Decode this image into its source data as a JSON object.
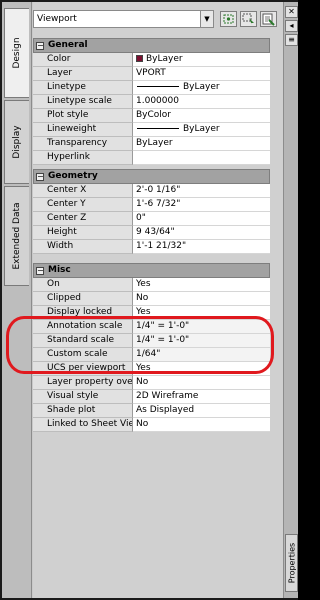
{
  "tabs": {
    "design": "Design",
    "display": "Display",
    "extended": "Extended Data",
    "properties": "Properties"
  },
  "selector": {
    "value": "Viewport"
  },
  "icons": {
    "toggle_pickadd": "pickadd-icon",
    "select_objects": "select-objects-icon",
    "quick_select": "quick-select-icon",
    "close": "close-icon",
    "autohide": "autohide-icon",
    "menu": "menu-icon"
  },
  "colors": {
    "color_swatch": "#7a1030",
    "highlight": "#e0191e"
  },
  "general": {
    "title": "General",
    "toggle": "−",
    "color": {
      "label": "Color",
      "value": "ByLayer"
    },
    "layer": {
      "label": "Layer",
      "value": "VPORT"
    },
    "linetype": {
      "label": "Linetype",
      "value": "ByLayer"
    },
    "linetype_scale": {
      "label": "Linetype scale",
      "value": "1.000000"
    },
    "plot_style": {
      "label": "Plot style",
      "value": "ByColor"
    },
    "lineweight": {
      "label": "Lineweight",
      "value": "ByLayer"
    },
    "transparency": {
      "label": "Transparency",
      "value": "ByLayer"
    },
    "hyperlink": {
      "label": "Hyperlink",
      "value": ""
    }
  },
  "geometry": {
    "title": "Geometry",
    "toggle": "−",
    "center_x": {
      "label": "Center X",
      "value": "2'-0 1/16\""
    },
    "center_y": {
      "label": "Center Y",
      "value": "1'-6 7/32\""
    },
    "center_z": {
      "label": "Center Z",
      "value": "0\""
    },
    "height": {
      "label": "Height",
      "value": "9 43/64\""
    },
    "width": {
      "label": "Width",
      "value": "1'-1 21/32\""
    }
  },
  "misc": {
    "title": "Misc",
    "toggle": "−",
    "on": {
      "label": "On",
      "value": "Yes"
    },
    "clipped": {
      "label": "Clipped",
      "value": "No"
    },
    "display_locked": {
      "label": "Display locked",
      "value": "Yes"
    },
    "annotation_scale": {
      "label": "Annotation scale",
      "value": "1/4\" = 1'-0\""
    },
    "standard_scale": {
      "label": "Standard scale",
      "value": "1/4\" = 1'-0\""
    },
    "custom_scale": {
      "label": "Custom scale",
      "value": "1/64\""
    },
    "ucs_per_viewport": {
      "label": "UCS per viewport",
      "value": "Yes"
    },
    "layer_property_overrides": {
      "label": "Layer property overrides",
      "value": "No"
    },
    "visual_style": {
      "label": "Visual style",
      "value": "2D Wireframe"
    },
    "shade_plot": {
      "label": "Shade plot",
      "value": "As Displayed"
    },
    "linked_to_sheet_view": {
      "label": "Linked to Sheet View",
      "value": "No"
    }
  }
}
